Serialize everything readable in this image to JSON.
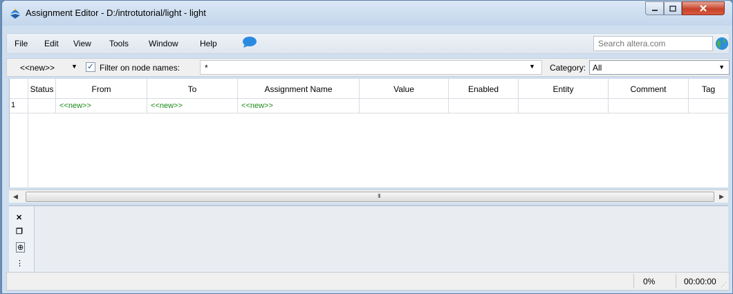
{
  "window": {
    "title": "Assignment Editor - D:/introtutorial/light - light",
    "controls": {
      "minimize": "▭",
      "maximize": "▢",
      "close": "X"
    }
  },
  "menu": {
    "items": [
      "File",
      "Edit",
      "View",
      "Tools",
      "Window",
      "Help"
    ],
    "search_placeholder": "Search altera.com"
  },
  "filter": {
    "node_selector": "<<new>>",
    "filter_checked": true,
    "filter_label": "Filter on node names:",
    "filter_value": "*",
    "category_label": "Category:",
    "category_value": "All"
  },
  "table": {
    "columns": [
      "Status",
      "From",
      "To",
      "Assignment Name",
      "Value",
      "Enabled",
      "Entity",
      "Comment",
      "Tag"
    ],
    "rows": [
      {
        "num": "1",
        "status": "",
        "from": "<<new>>",
        "to": "<<new>>",
        "assignment_name": "<<new>>",
        "value": "",
        "enabled": "",
        "entity": "",
        "comment": "",
        "tag": ""
      }
    ]
  },
  "scrollbar": {
    "grip": "III"
  },
  "status": {
    "progress": "0%",
    "elapsed": "00:00:00"
  },
  "colors": {
    "new_entry": "#1a8a1a",
    "accent": "#2c5a9a"
  }
}
